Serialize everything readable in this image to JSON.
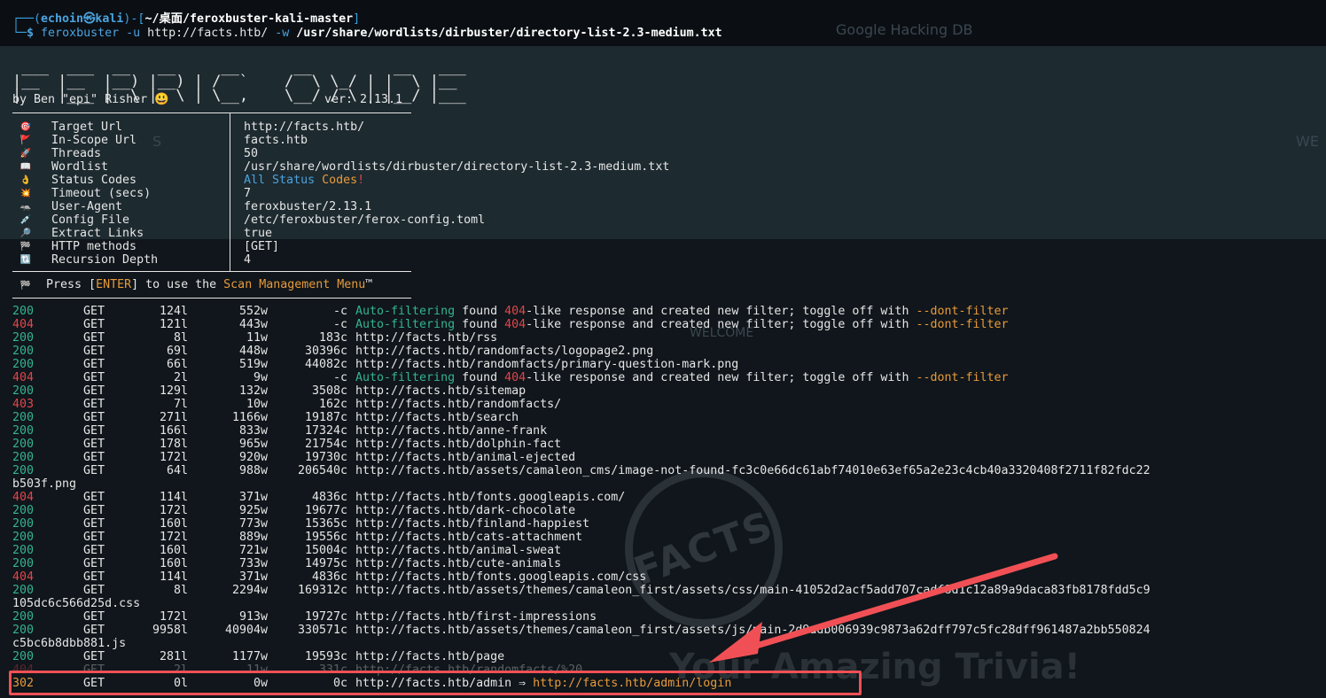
{
  "background": {
    "ghost_google": "Google Hacking DB",
    "ghost_we": "WE",
    "ghost_s": "S",
    "ghost_welcome": "WELCOME",
    "stamp_text": "FACTS",
    "trivia_text": "Your Amazing Trivia!"
  },
  "prompt": {
    "user": "echoin",
    "at": "㉿",
    "host": "kali",
    "path": "~/桌面/feroxbuster-kali-master",
    "dollar": "$",
    "cmd": "feroxbuster",
    "arg_u": "-u",
    "url": "http://facts.htb/",
    "arg_w": "-w",
    "wordlist": "/usr/share/wordlists/dirbuster/directory-list-2.3-medium.txt"
  },
  "banner": {
    "art": " ___  ___  __   __     __      __         __   ___\n|__  |__  |__) |__) | /  `    /  \\ \\_/ | |  \\ |__\n|    |___ |  \\ |  \\ | \\__,    \\__/ / \\ | |__/ |___",
    "by": "by Ben \"epi\" Risher 😃",
    "version": "ver: 2.13.1"
  },
  "config": [
    {
      "icon": "🎯",
      "label": "Target Url",
      "value": "http://facts.htb/"
    },
    {
      "icon": "🚩",
      "label": "In-Scope Url",
      "value": "facts.htb"
    },
    {
      "icon": "🚀",
      "label": "Threads",
      "value": "50"
    },
    {
      "icon": "📖",
      "label": "Wordlist",
      "value": "/usr/share/wordlists/dirbuster/directory-list-2.3-medium.txt"
    },
    {
      "icon": "👌",
      "label": "Status Codes",
      "value": ""
    },
    {
      "icon": "💥",
      "label": "Timeout (secs)",
      "value": "7"
    },
    {
      "icon": "🦡",
      "label": "User-Agent",
      "value": "feroxbuster/2.13.1"
    },
    {
      "icon": "💉",
      "label": "Config File",
      "value": "/etc/feroxbuster/ferox-config.toml"
    },
    {
      "icon": "🔎",
      "label": "Extract Links",
      "value": "true"
    },
    {
      "icon": "🏁",
      "label": "HTTP methods",
      "value": "[GET]"
    },
    {
      "icon": "🔃",
      "label": "Recursion Depth",
      "value": "4"
    }
  ],
  "status_codes_value": {
    "part1": "All",
    "part2": "Status",
    "part3": "Codes",
    "part4": "!"
  },
  "press_line": {
    "icon": "🏁",
    "pre": "Press [",
    "key": "ENTER",
    "mid": "] to use the ",
    "menu": "Scan Management Menu",
    "tm": "™"
  },
  "colors": {
    "ok": "#34b391",
    "error": "#e0464c",
    "warn": "#e89a3a",
    "link": "#4aa3df",
    "highlight_box": "#f05055"
  },
  "results": [
    {
      "code": "200",
      "method": "GET",
      "lines": "124l",
      "words": "552w",
      "chars": "-c",
      "filter": true
    },
    {
      "code": "404",
      "method": "GET",
      "lines": "121l",
      "words": "443w",
      "chars": "-c",
      "filter": true
    },
    {
      "code": "200",
      "method": "GET",
      "lines": "8l",
      "words": "11w",
      "chars": "183c",
      "url": "http://facts.htb/rss"
    },
    {
      "code": "200",
      "method": "GET",
      "lines": "69l",
      "words": "448w",
      "chars": "30396c",
      "url": "http://facts.htb/randomfacts/logopage2.png"
    },
    {
      "code": "200",
      "method": "GET",
      "lines": "66l",
      "words": "519w",
      "chars": "44082c",
      "url": "http://facts.htb/randomfacts/primary-question-mark.png"
    },
    {
      "code": "404",
      "method": "GET",
      "lines": "2l",
      "words": "9w",
      "chars": "-c",
      "filter": true
    },
    {
      "code": "200",
      "method": "GET",
      "lines": "129l",
      "words": "132w",
      "chars": "3508c",
      "url": "http://facts.htb/sitemap"
    },
    {
      "code": "403",
      "method": "GET",
      "lines": "7l",
      "words": "10w",
      "chars": "162c",
      "url": "http://facts.htb/randomfacts/"
    },
    {
      "code": "200",
      "method": "GET",
      "lines": "271l",
      "words": "1166w",
      "chars": "19187c",
      "url": "http://facts.htb/search"
    },
    {
      "code": "200",
      "method": "GET",
      "lines": "166l",
      "words": "833w",
      "chars": "17324c",
      "url": "http://facts.htb/anne-frank"
    },
    {
      "code": "200",
      "method": "GET",
      "lines": "178l",
      "words": "965w",
      "chars": "21754c",
      "url": "http://facts.htb/dolphin-fact"
    },
    {
      "code": "200",
      "method": "GET",
      "lines": "172l",
      "words": "920w",
      "chars": "19730c",
      "url": "http://facts.htb/animal-ejected"
    },
    {
      "code": "200",
      "method": "GET",
      "lines": "64l",
      "words": "988w",
      "chars": "206540c",
      "url": "http://facts.htb/assets/camaleon_cms/image-not-found-fc3c0e66dc61abf74010e63ef65a2e23c4cb40a3320408f2711f82fdc22",
      "wrap": "b503f.png"
    },
    {
      "code": "404",
      "method": "GET",
      "lines": "114l",
      "words": "371w",
      "chars": "4836c",
      "url": "http://facts.htb/fonts.googleapis.com/"
    },
    {
      "code": "200",
      "method": "GET",
      "lines": "172l",
      "words": "925w",
      "chars": "19677c",
      "url": "http://facts.htb/dark-chocolate"
    },
    {
      "code": "200",
      "method": "GET",
      "lines": "160l",
      "words": "773w",
      "chars": "15365c",
      "url": "http://facts.htb/finland-happiest"
    },
    {
      "code": "200",
      "method": "GET",
      "lines": "172l",
      "words": "889w",
      "chars": "19556c",
      "url": "http://facts.htb/cats-attachment"
    },
    {
      "code": "200",
      "method": "GET",
      "lines": "160l",
      "words": "721w",
      "chars": "15004c",
      "url": "http://facts.htb/animal-sweat"
    },
    {
      "code": "200",
      "method": "GET",
      "lines": "160l",
      "words": "733w",
      "chars": "14975c",
      "url": "http://facts.htb/cute-animals"
    },
    {
      "code": "404",
      "method": "GET",
      "lines": "114l",
      "words": "371w",
      "chars": "4836c",
      "url": "http://facts.htb/fonts.googleapis.com/css"
    },
    {
      "code": "200",
      "method": "GET",
      "lines": "8l",
      "words": "2294w",
      "chars": "169312c",
      "url": "http://facts.htb/assets/themes/camaleon_first/assets/css/main-41052d2acf5add707cadf8d1c12a89a9daca83fb8178fdd5c9",
      "wrap": "105dc6c566d25d.css"
    },
    {
      "code": "200",
      "method": "GET",
      "lines": "172l",
      "words": "913w",
      "chars": "19727c",
      "url": "http://facts.htb/first-impressions"
    },
    {
      "code": "200",
      "method": "GET",
      "lines": "9958l",
      "words": "40904w",
      "chars": "330571c",
      "url": "http://facts.htb/assets/themes/camaleon_first/assets/js/main-2d9adb006939c9873a62dff797c5fc28dff961487a2bb550824",
      "wrap": "c5bc6b8dbb881.js"
    },
    {
      "code": "200",
      "method": "GET",
      "lines": "281l",
      "words": "1177w",
      "chars": "19593c",
      "url": "http://facts.htb/page"
    },
    {
      "code": "404",
      "method": "GET",
      "lines": "2l",
      "words": "11w",
      "chars": "331c",
      "url": "http://facts.htb/randomfacts/%20"
    },
    {
      "code": "302",
      "method": "GET",
      "lines": "0l",
      "words": "0w",
      "chars": "0c",
      "url": "http://facts.htb/admin",
      "arrow": "⇒",
      "redirect": "http://facts.htb/admin/login"
    }
  ],
  "filter_msg": {
    "a": "Auto-filtering",
    "b": " found ",
    "c": "404",
    "d": "-like response and created new filter; toggle off with ",
    "e": "--dont-filter"
  }
}
